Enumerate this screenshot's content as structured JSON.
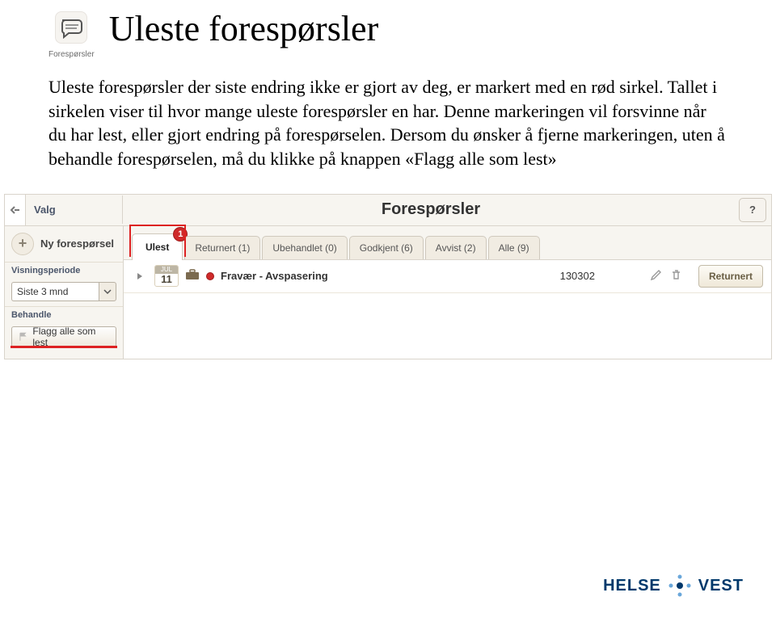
{
  "app_icon_label": "Forespørsler",
  "doc_title": "Uleste forespørsler",
  "doc_body": "Uleste forespørsler der siste endring ikke er gjort av deg, er markert med en rød sirkel. Tallet i sirkelen viser til hvor mange uleste forespørsler en har. Denne markeringen vil forsvinne når du har lest, eller gjort endring på forespørselen. Dersom du ønsker å fjerne markeringen, uten å behandle forespørselen, må du klikke på knappen «Flagg alle som lest»",
  "shot": {
    "valg": "Valg",
    "title": "Forespørsler",
    "ny_label": "Ny forespørsel",
    "visningsperiode_label": "Visningsperiode",
    "period_value": "Siste 3 mnd",
    "behandle_label": "Behandle",
    "flag_button": "Flagg alle som lest",
    "tabs": {
      "ulest": "Ulest",
      "ulest_badge": "1",
      "returnert": "Returnert (1)",
      "ubehandlet": "Ubehandlet (0)",
      "godkjent": "Godkjent (6)",
      "avvist": "Avvist (2)",
      "alle": "Alle (9)"
    },
    "row": {
      "month": "JUL",
      "day": "11",
      "label": "Fravær - Avspasering",
      "id": "130302",
      "status": "Returnert"
    }
  },
  "footer": {
    "brand1": "HELSE",
    "brand2": "VEST"
  }
}
